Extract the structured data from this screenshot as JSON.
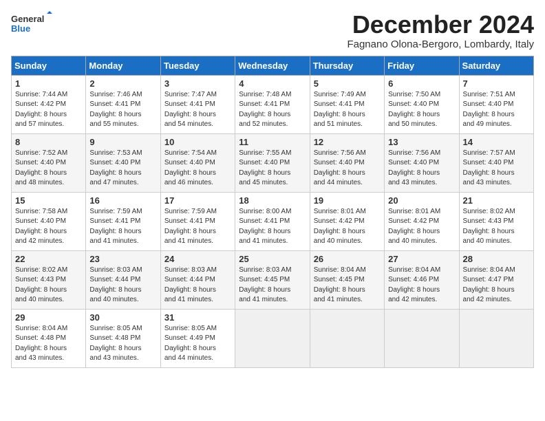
{
  "logo": {
    "text_general": "General",
    "text_blue": "Blue"
  },
  "title": "December 2024",
  "location": "Fagnano Olona-Bergoro, Lombardy, Italy",
  "weekdays": [
    "Sunday",
    "Monday",
    "Tuesday",
    "Wednesday",
    "Thursday",
    "Friday",
    "Saturday"
  ],
  "weeks": [
    [
      {
        "day": "1",
        "info": "Sunrise: 7:44 AM\nSunset: 4:42 PM\nDaylight: 8 hours\nand 57 minutes."
      },
      {
        "day": "2",
        "info": "Sunrise: 7:46 AM\nSunset: 4:41 PM\nDaylight: 8 hours\nand 55 minutes."
      },
      {
        "day": "3",
        "info": "Sunrise: 7:47 AM\nSunset: 4:41 PM\nDaylight: 8 hours\nand 54 minutes."
      },
      {
        "day": "4",
        "info": "Sunrise: 7:48 AM\nSunset: 4:41 PM\nDaylight: 8 hours\nand 52 minutes."
      },
      {
        "day": "5",
        "info": "Sunrise: 7:49 AM\nSunset: 4:41 PM\nDaylight: 8 hours\nand 51 minutes."
      },
      {
        "day": "6",
        "info": "Sunrise: 7:50 AM\nSunset: 4:40 PM\nDaylight: 8 hours\nand 50 minutes."
      },
      {
        "day": "7",
        "info": "Sunrise: 7:51 AM\nSunset: 4:40 PM\nDaylight: 8 hours\nand 49 minutes."
      }
    ],
    [
      {
        "day": "8",
        "info": "Sunrise: 7:52 AM\nSunset: 4:40 PM\nDaylight: 8 hours\nand 48 minutes."
      },
      {
        "day": "9",
        "info": "Sunrise: 7:53 AM\nSunset: 4:40 PM\nDaylight: 8 hours\nand 47 minutes."
      },
      {
        "day": "10",
        "info": "Sunrise: 7:54 AM\nSunset: 4:40 PM\nDaylight: 8 hours\nand 46 minutes."
      },
      {
        "day": "11",
        "info": "Sunrise: 7:55 AM\nSunset: 4:40 PM\nDaylight: 8 hours\nand 45 minutes."
      },
      {
        "day": "12",
        "info": "Sunrise: 7:56 AM\nSunset: 4:40 PM\nDaylight: 8 hours\nand 44 minutes."
      },
      {
        "day": "13",
        "info": "Sunrise: 7:56 AM\nSunset: 4:40 PM\nDaylight: 8 hours\nand 43 minutes."
      },
      {
        "day": "14",
        "info": "Sunrise: 7:57 AM\nSunset: 4:40 PM\nDaylight: 8 hours\nand 43 minutes."
      }
    ],
    [
      {
        "day": "15",
        "info": "Sunrise: 7:58 AM\nSunset: 4:40 PM\nDaylight: 8 hours\nand 42 minutes."
      },
      {
        "day": "16",
        "info": "Sunrise: 7:59 AM\nSunset: 4:41 PM\nDaylight: 8 hours\nand 41 minutes."
      },
      {
        "day": "17",
        "info": "Sunrise: 7:59 AM\nSunset: 4:41 PM\nDaylight: 8 hours\nand 41 minutes."
      },
      {
        "day": "18",
        "info": "Sunrise: 8:00 AM\nSunset: 4:41 PM\nDaylight: 8 hours\nand 41 minutes."
      },
      {
        "day": "19",
        "info": "Sunrise: 8:01 AM\nSunset: 4:42 PM\nDaylight: 8 hours\nand 40 minutes."
      },
      {
        "day": "20",
        "info": "Sunrise: 8:01 AM\nSunset: 4:42 PM\nDaylight: 8 hours\nand 40 minutes."
      },
      {
        "day": "21",
        "info": "Sunrise: 8:02 AM\nSunset: 4:43 PM\nDaylight: 8 hours\nand 40 minutes."
      }
    ],
    [
      {
        "day": "22",
        "info": "Sunrise: 8:02 AM\nSunset: 4:43 PM\nDaylight: 8 hours\nand 40 minutes."
      },
      {
        "day": "23",
        "info": "Sunrise: 8:03 AM\nSunset: 4:44 PM\nDaylight: 8 hours\nand 40 minutes."
      },
      {
        "day": "24",
        "info": "Sunrise: 8:03 AM\nSunset: 4:44 PM\nDaylight: 8 hours\nand 41 minutes."
      },
      {
        "day": "25",
        "info": "Sunrise: 8:03 AM\nSunset: 4:45 PM\nDaylight: 8 hours\nand 41 minutes."
      },
      {
        "day": "26",
        "info": "Sunrise: 8:04 AM\nSunset: 4:45 PM\nDaylight: 8 hours\nand 41 minutes."
      },
      {
        "day": "27",
        "info": "Sunrise: 8:04 AM\nSunset: 4:46 PM\nDaylight: 8 hours\nand 42 minutes."
      },
      {
        "day": "28",
        "info": "Sunrise: 8:04 AM\nSunset: 4:47 PM\nDaylight: 8 hours\nand 42 minutes."
      }
    ],
    [
      {
        "day": "29",
        "info": "Sunrise: 8:04 AM\nSunset: 4:48 PM\nDaylight: 8 hours\nand 43 minutes."
      },
      {
        "day": "30",
        "info": "Sunrise: 8:05 AM\nSunset: 4:48 PM\nDaylight: 8 hours\nand 43 minutes."
      },
      {
        "day": "31",
        "info": "Sunrise: 8:05 AM\nSunset: 4:49 PM\nDaylight: 8 hours\nand 44 minutes."
      },
      {
        "day": "",
        "info": ""
      },
      {
        "day": "",
        "info": ""
      },
      {
        "day": "",
        "info": ""
      },
      {
        "day": "",
        "info": ""
      }
    ]
  ]
}
